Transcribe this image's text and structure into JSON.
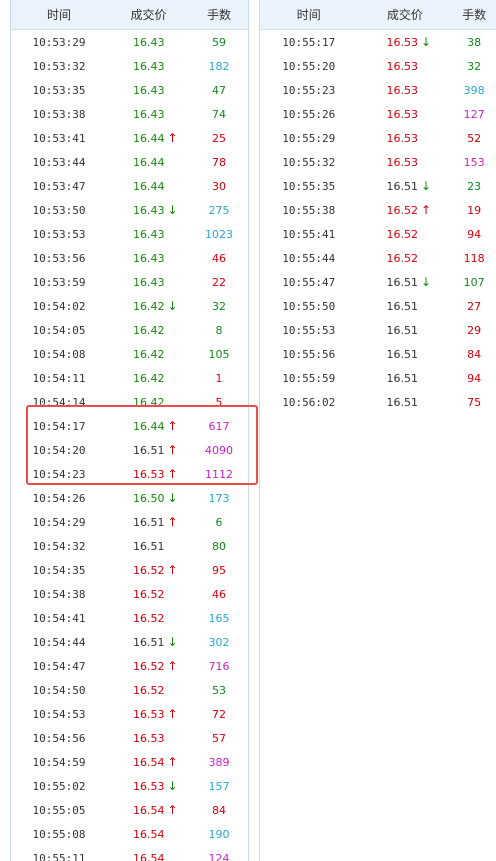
{
  "colors": {
    "up": "#d4000a",
    "down": "#148a0a",
    "neutral": "#333333",
    "vol_green": "#128a1e",
    "vol_red": "#d4000a",
    "vol_cyan": "#27a9cf",
    "vol_magenta": "#cc1fc8",
    "highlight_border": "#ea4c4c"
  },
  "headers": {
    "time": "时间",
    "price": "成交价",
    "volume": "手数"
  },
  "left_table": [
    {
      "time": "10:53:29",
      "price": "16.43",
      "pc": "down",
      "arrow": "",
      "vol": "59",
      "vc": "green"
    },
    {
      "time": "10:53:32",
      "price": "16.43",
      "pc": "down",
      "arrow": "",
      "vol": "182",
      "vc": "cyan"
    },
    {
      "time": "10:53:35",
      "price": "16.43",
      "pc": "down",
      "arrow": "",
      "vol": "47",
      "vc": "green"
    },
    {
      "time": "10:53:38",
      "price": "16.43",
      "pc": "down",
      "arrow": "",
      "vol": "74",
      "vc": "green"
    },
    {
      "time": "10:53:41",
      "price": "16.44",
      "pc": "down",
      "arrow": "up",
      "vol": "25",
      "vc": "red"
    },
    {
      "time": "10:53:44",
      "price": "16.44",
      "pc": "down",
      "arrow": "",
      "vol": "78",
      "vc": "red"
    },
    {
      "time": "10:53:47",
      "price": "16.44",
      "pc": "down",
      "arrow": "",
      "vol": "30",
      "vc": "red"
    },
    {
      "time": "10:53:50",
      "price": "16.43",
      "pc": "down",
      "arrow": "down",
      "vol": "275",
      "vc": "cyan"
    },
    {
      "time": "10:53:53",
      "price": "16.43",
      "pc": "down",
      "arrow": "",
      "vol": "1023",
      "vc": "cyan"
    },
    {
      "time": "10:53:56",
      "price": "16.43",
      "pc": "down",
      "arrow": "",
      "vol": "46",
      "vc": "red"
    },
    {
      "time": "10:53:59",
      "price": "16.43",
      "pc": "down",
      "arrow": "",
      "vol": "22",
      "vc": "red"
    },
    {
      "time": "10:54:02",
      "price": "16.42",
      "pc": "down",
      "arrow": "down",
      "vol": "32",
      "vc": "green"
    },
    {
      "time": "10:54:05",
      "price": "16.42",
      "pc": "down",
      "arrow": "",
      "vol": "8",
      "vc": "green"
    },
    {
      "time": "10:54:08",
      "price": "16.42",
      "pc": "down",
      "arrow": "",
      "vol": "105",
      "vc": "green"
    },
    {
      "time": "10:54:11",
      "price": "16.42",
      "pc": "down",
      "arrow": "",
      "vol": "1",
      "vc": "red"
    },
    {
      "time": "10:54:14",
      "price": "16.42",
      "pc": "down",
      "arrow": "",
      "vol": "5",
      "vc": "red"
    },
    {
      "time": "10:54:17",
      "price": "16.44",
      "pc": "down",
      "arrow": "up",
      "vol": "617",
      "vc": "magenta"
    },
    {
      "time": "10:54:20",
      "price": "16.51",
      "pc": "neutral",
      "arrow": "up",
      "vol": "4090",
      "vc": "magenta"
    },
    {
      "time": "10:54:23",
      "price": "16.53",
      "pc": "up",
      "arrow": "up",
      "vol": "1112",
      "vc": "magenta"
    },
    {
      "time": "10:54:26",
      "price": "16.50",
      "pc": "down",
      "arrow": "down",
      "vol": "173",
      "vc": "cyan"
    },
    {
      "time": "10:54:29",
      "price": "16.51",
      "pc": "neutral",
      "arrow": "up",
      "vol": "6",
      "vc": "green"
    },
    {
      "time": "10:54:32",
      "price": "16.51",
      "pc": "neutral",
      "arrow": "",
      "vol": "80",
      "vc": "green"
    },
    {
      "time": "10:54:35",
      "price": "16.52",
      "pc": "up",
      "arrow": "up",
      "vol": "95",
      "vc": "red"
    },
    {
      "time": "10:54:38",
      "price": "16.52",
      "pc": "up",
      "arrow": "",
      "vol": "46",
      "vc": "red"
    },
    {
      "time": "10:54:41",
      "price": "16.52",
      "pc": "up",
      "arrow": "",
      "vol": "165",
      "vc": "cyan"
    },
    {
      "time": "10:54:44",
      "price": "16.51",
      "pc": "neutral",
      "arrow": "down",
      "vol": "302",
      "vc": "cyan"
    },
    {
      "time": "10:54:47",
      "price": "16.52",
      "pc": "up",
      "arrow": "up",
      "vol": "716",
      "vc": "magenta"
    },
    {
      "time": "10:54:50",
      "price": "16.52",
      "pc": "up",
      "arrow": "",
      "vol": "53",
      "vc": "green"
    },
    {
      "time": "10:54:53",
      "price": "16.53",
      "pc": "up",
      "arrow": "up",
      "vol": "72",
      "vc": "red"
    },
    {
      "time": "10:54:56",
      "price": "16.53",
      "pc": "up",
      "arrow": "",
      "vol": "57",
      "vc": "red"
    },
    {
      "time": "10:54:59",
      "price": "16.54",
      "pc": "up",
      "arrow": "up",
      "vol": "389",
      "vc": "magenta"
    },
    {
      "time": "10:55:02",
      "price": "16.53",
      "pc": "up",
      "arrow": "down",
      "vol": "157",
      "vc": "cyan"
    },
    {
      "time": "10:55:05",
      "price": "16.54",
      "pc": "up",
      "arrow": "up",
      "vol": "84",
      "vc": "red"
    },
    {
      "time": "10:55:08",
      "price": "16.54",
      "pc": "up",
      "arrow": "",
      "vol": "190",
      "vc": "cyan"
    },
    {
      "time": "10:55:11",
      "price": "16.54",
      "pc": "up",
      "arrow": "",
      "vol": "124",
      "vc": "magenta"
    }
  ],
  "right_table": [
    {
      "time": "10:55:17",
      "price": "16.53",
      "pc": "up",
      "arrow": "down",
      "vol": "38",
      "vc": "green"
    },
    {
      "time": "10:55:20",
      "price": "16.53",
      "pc": "up",
      "arrow": "",
      "vol": "32",
      "vc": "green"
    },
    {
      "time": "10:55:23",
      "price": "16.53",
      "pc": "up",
      "arrow": "",
      "vol": "398",
      "vc": "cyan"
    },
    {
      "time": "10:55:26",
      "price": "16.53",
      "pc": "up",
      "arrow": "",
      "vol": "127",
      "vc": "magenta"
    },
    {
      "time": "10:55:29",
      "price": "16.53",
      "pc": "up",
      "arrow": "",
      "vol": "52",
      "vc": "red"
    },
    {
      "time": "10:55:32",
      "price": "16.53",
      "pc": "up",
      "arrow": "",
      "vol": "153",
      "vc": "magenta"
    },
    {
      "time": "10:55:35",
      "price": "16.51",
      "pc": "neutral",
      "arrow": "down",
      "vol": "23",
      "vc": "green"
    },
    {
      "time": "10:55:38",
      "price": "16.52",
      "pc": "up",
      "arrow": "up",
      "vol": "19",
      "vc": "red"
    },
    {
      "time": "10:55:41",
      "price": "16.52",
      "pc": "up",
      "arrow": "",
      "vol": "94",
      "vc": "red"
    },
    {
      "time": "10:55:44",
      "price": "16.52",
      "pc": "up",
      "arrow": "",
      "vol": "118",
      "vc": "red"
    },
    {
      "time": "10:55:47",
      "price": "16.51",
      "pc": "neutral",
      "arrow": "down",
      "vol": "107",
      "vc": "green"
    },
    {
      "time": "10:55:50",
      "price": "16.51",
      "pc": "neutral",
      "arrow": "",
      "vol": "27",
      "vc": "red"
    },
    {
      "time": "10:55:53",
      "price": "16.51",
      "pc": "neutral",
      "arrow": "",
      "vol": "29",
      "vc": "red"
    },
    {
      "time": "10:55:56",
      "price": "16.51",
      "pc": "neutral",
      "arrow": "",
      "vol": "84",
      "vc": "red"
    },
    {
      "time": "10:55:59",
      "price": "16.51",
      "pc": "neutral",
      "arrow": "",
      "vol": "94",
      "vc": "red"
    },
    {
      "time": "10:56:02",
      "price": "16.51",
      "pc": "neutral",
      "arrow": "",
      "vol": "75",
      "vc": "red"
    }
  ]
}
